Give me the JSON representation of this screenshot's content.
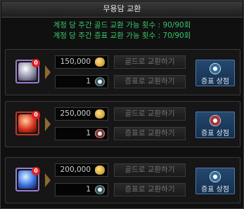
{
  "window": {
    "title": "무용담 교환"
  },
  "counts": {
    "gold_line": "계정 당 주간 골드 교환 가능 횟수 : 90/90회",
    "token_line": "계정 당 주간 증표 교환 가능 횟수 : 70/90회"
  },
  "rows": [
    {
      "gem_color": "#8f8fa8",
      "badge": "0",
      "gold_amount": "150,000",
      "token_amount": "1",
      "gold_button": "골드로 교환하기",
      "token_button": "증표로 교환하기",
      "shop_button": "증표 상점",
      "token_icon": "token-blue-icon"
    },
    {
      "gem_color": "#d8321e",
      "badge": "0",
      "gold_amount": "250,000",
      "token_amount": "1",
      "gold_button": "골드로 교환하기",
      "token_button": "증표로 교환하기",
      "shop_button": "증표 상점",
      "token_icon": "token-red-icon"
    },
    {
      "gem_color": "#3a6fe0",
      "badge": "0",
      "gold_amount": "200,000",
      "token_amount": "1",
      "gold_button": "골드로 교환하기",
      "token_button": "증표로 교환하기",
      "shop_button": "증표 상점",
      "token_icon": "token-blue-icon"
    }
  ],
  "colors": {
    "counts_text": "#39c46a",
    "shop_button_bg": "#1d3a5c"
  }
}
